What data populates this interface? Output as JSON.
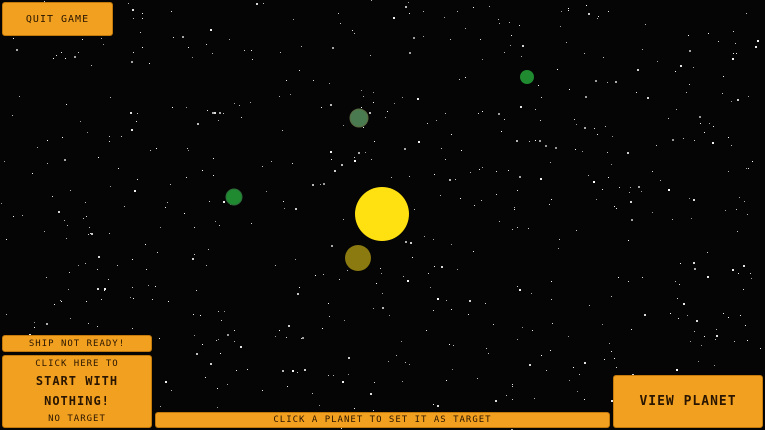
{
  "buttons": {
    "quit": "QUIT GAME",
    "view_planet": "VIEW PLANET"
  },
  "ship_status": "SHIP NOT READY!",
  "start_panel": {
    "prompt": "CLICK HERE TO",
    "action_line1": "START WITH",
    "action_line2": "NOTHING!",
    "target": "NO TARGET"
  },
  "status_bar": "CLICK A PLANET TO SET IT AS TARGET",
  "colors": {
    "button_bg": "#f2a020",
    "button_text": "#2a1600",
    "sun": "#ffe010",
    "planet_green": "#1f8a30",
    "planet_grey_green": "#4a7a50",
    "planet_olive": "#8a7a10",
    "background": "#050505"
  },
  "scene": {
    "sun": "sun",
    "planets": [
      "green-planet",
      "grey-green-planet",
      "green-planet",
      "olive-planet"
    ]
  }
}
